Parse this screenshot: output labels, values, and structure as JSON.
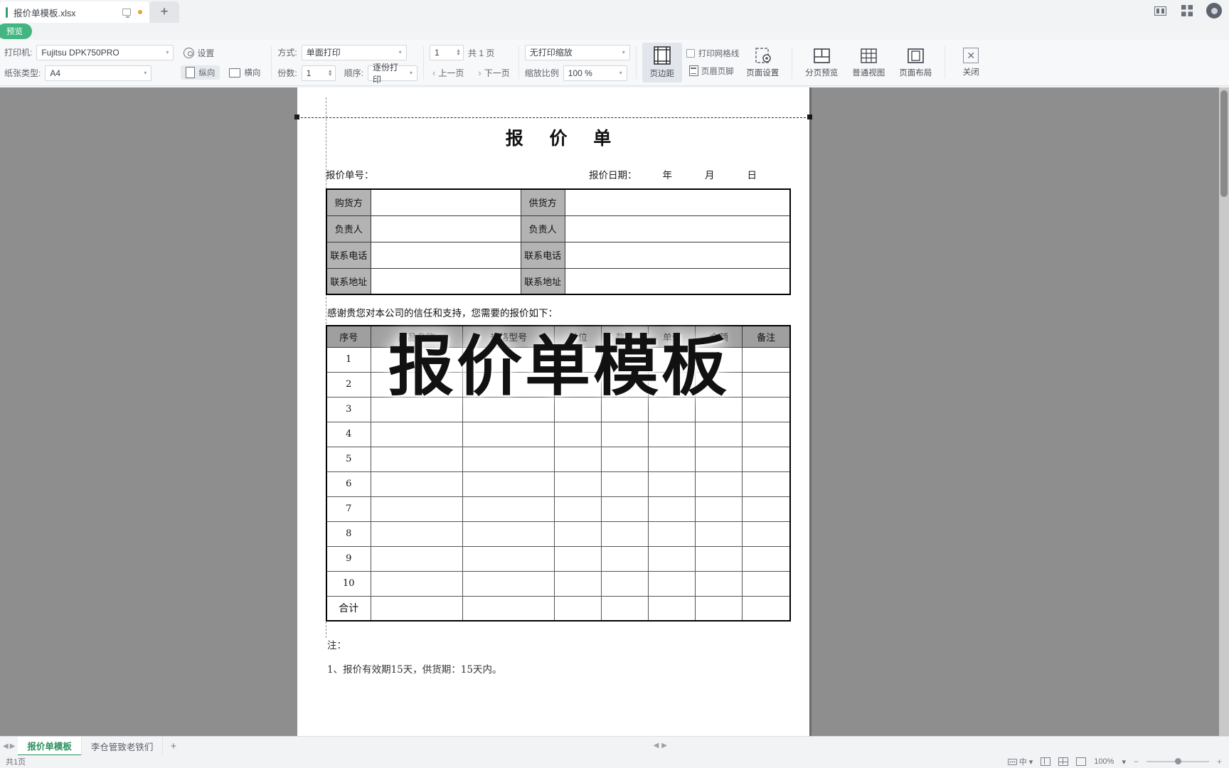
{
  "titlebar": {
    "doc_tab_title": "报价单模板.xlsx",
    "monitor_icon": "monitor-icon",
    "modified_dot": "unsaved-dot",
    "new_tab_label": "+",
    "right_icons": [
      "restore-icon",
      "grid-icon",
      "avatar-icon"
    ]
  },
  "preview_badge": "预览",
  "toolbar": {
    "printer_label": "打印机:",
    "printer_value": "Fujitsu DPK750PRO",
    "settings_label": "设置",
    "paper_label": "纸张类型:",
    "paper_value": "A4",
    "orientation_portrait": "纵向",
    "orientation_landscape": "横向",
    "mode_label": "方式:",
    "mode_value": "单面打印",
    "copies_label": "份数:",
    "copies_value": "1",
    "order_label": "顺序:",
    "order_value": "逐份打印",
    "page_current": "1",
    "page_total": "共 1 页",
    "prev_page": "上一页",
    "next_page": "下一页",
    "fit_value": "无打印缩放",
    "zoom_label": "缩放比例",
    "zoom_value": "100 %",
    "margins_button": "页边距",
    "print_gridlines": "打印网格线",
    "header_footer": "页眉页脚",
    "page_setup": "页面设置",
    "page_break_preview": "分页预览",
    "normal_view": "普通视图",
    "page_layout": "页面布局",
    "close_button": "关闭"
  },
  "document": {
    "title": "报 价 单",
    "quote_no_label": "报价单号：",
    "quote_date_label": "报价日期：",
    "year": "年",
    "month": "月",
    "day": "日",
    "party_rows": [
      {
        "left_label": "购货方",
        "right_label": "供货方"
      },
      {
        "left_label": "负责人",
        "right_label": "负责人"
      },
      {
        "left_label": "联系电话",
        "right_label": "联系电话"
      },
      {
        "left_label": "联系地址",
        "right_label": "联系地址"
      }
    ],
    "thanks_text": "感谢贵您对本公司的信任和支持，您需要的报价如下：",
    "item_headers": [
      "序号",
      "产品名称",
      "规格型号",
      "单位",
      "数量",
      "单价",
      "金额",
      "备注"
    ],
    "item_rows": [
      "1",
      "2",
      "3",
      "4",
      "5",
      "6",
      "7",
      "8",
      "9",
      "10"
    ],
    "total_label": "合计",
    "note_label": "注：",
    "note_line_1": "1、报价有效期15天，供货期：15天内。",
    "watermark": "报价单模板"
  },
  "sheets": {
    "tabs": [
      "报价单模板",
      "李仓管致老铁们"
    ],
    "active_index": 0,
    "add_label": "+"
  },
  "statusbar": {
    "page_info": "共1页",
    "lang": "中",
    "zoom_percent": "100%",
    "minus": "−",
    "plus": "+"
  },
  "colors": {
    "accent_green": "#43b581",
    "tab_active_green": "#2a8f5e",
    "header_gray": "#9f9f9f",
    "label_gray": "#b3b3b3"
  }
}
